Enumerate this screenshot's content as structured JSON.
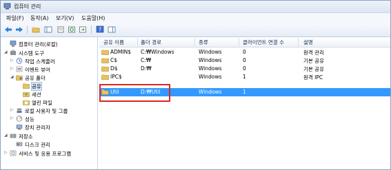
{
  "window": {
    "title": "컴퓨터 관리"
  },
  "menu": [
    "파일(F)",
    "동작(A)",
    "보기(V)",
    "도움말(H)"
  ],
  "toolbar": {
    "buttons": [
      "back-arrow-icon",
      "forward-arrow-icon",
      "up-folder-icon",
      "show-tree-icon",
      "properties-icon",
      "refresh-icon",
      "export-icon",
      "help-icon",
      "panel-icon"
    ]
  },
  "tree": [
    {
      "label": "컴퓨터 관리(로컬)",
      "icon": "computer-icon",
      "expander": ""
    },
    {
      "label": "시스템 도구",
      "icon": "tools-icon",
      "expander": "◢"
    },
    {
      "label": "작업 스케줄러",
      "icon": "clock-icon",
      "expander": "▷"
    },
    {
      "label": "이벤트 뷰어",
      "icon": "event-icon",
      "expander": "▷"
    },
    {
      "label": "공유 폴더",
      "icon": "shared-folder-icon",
      "expander": "◢"
    },
    {
      "label": "공유",
      "icon": "share-icon",
      "expander": ""
    },
    {
      "label": "세션",
      "icon": "session-icon",
      "expander": ""
    },
    {
      "label": "열린 파일",
      "icon": "file-icon",
      "expander": ""
    },
    {
      "label": "로컬 사용자 및 그룹",
      "icon": "users-icon",
      "expander": "▷"
    },
    {
      "label": "성능",
      "icon": "performance-icon",
      "expander": "▷"
    },
    {
      "label": "장치 관리자",
      "icon": "device-icon",
      "expander": ""
    },
    {
      "label": "저장소",
      "icon": "storage-icon",
      "expander": "◢"
    },
    {
      "label": "디스크 관리",
      "icon": "disk-icon",
      "expander": ""
    },
    {
      "label": "서비스 및 응용 프로그램",
      "icon": "services-icon",
      "expander": "▷"
    }
  ],
  "list": {
    "columns": [
      "공유 이름",
      "폴더 경로",
      "종류",
      "클라이언트 연결 수",
      "설명"
    ],
    "rows": [
      {
        "name": "ADMIN$",
        "path": "C:₩Windows",
        "type": "Windows",
        "clients": "0",
        "desc": "원격 관리"
      },
      {
        "name": "C$",
        "path": "C:₩",
        "type": "Windows",
        "clients": "0",
        "desc": "기본 공유"
      },
      {
        "name": "D$",
        "path": "D:₩",
        "type": "Windows",
        "clients": "0",
        "desc": "기본 공유"
      },
      {
        "name": "IPC$",
        "path": "",
        "type": "Windows",
        "clients": "1",
        "desc": "원격 IPC"
      },
      {
        "name": "Util",
        "path": "D:₩Util",
        "type": "Windows",
        "clients": "1",
        "desc": ""
      }
    ]
  },
  "colors": {
    "selection": "#3399ff",
    "highlight_box": "#e0241d"
  }
}
